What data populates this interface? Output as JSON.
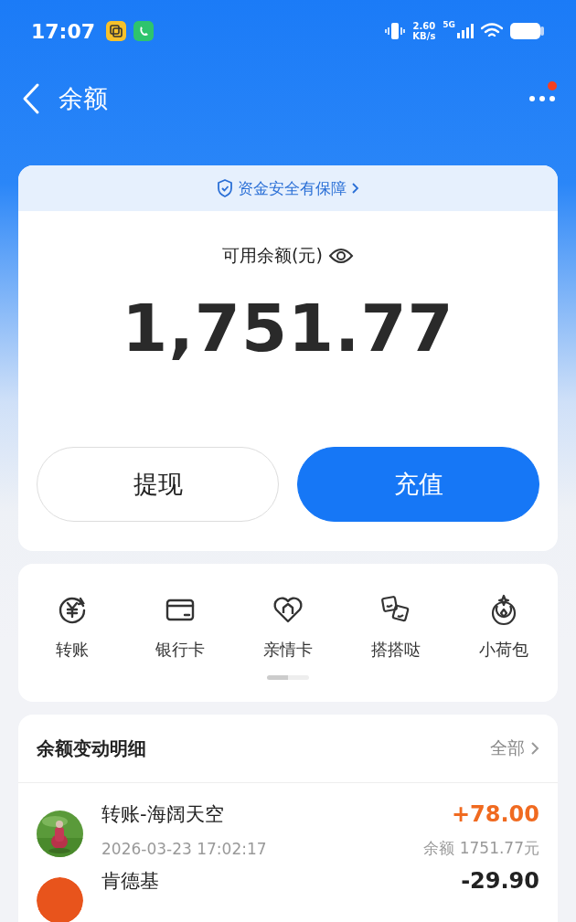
{
  "status_bar": {
    "time": "17:07",
    "network_speed": "2.60",
    "network_unit": "KB/s",
    "network_type": "5G"
  },
  "nav": {
    "title": "余额",
    "notification_dot": true
  },
  "balance_card": {
    "safety_banner": "资金安全有保障",
    "balance_label": "可用余额(元)",
    "balance": "1,751.77",
    "buttons": [
      {
        "label": "提现",
        "kind": "secondary"
      },
      {
        "label": "充值",
        "kind": "primary"
      }
    ]
  },
  "shortcuts": {
    "items": [
      {
        "label": "转账",
        "kind": "transfer"
      },
      {
        "label": "银行卡",
        "kind": "card"
      },
      {
        "label": "亲情卡",
        "kind": "family"
      },
      {
        "label": "搭搭哒",
        "kind": "dice"
      },
      {
        "label": "小荷包",
        "kind": "pouch"
      }
    ],
    "pages": [
      {
        "selected": true
      },
      {
        "selected": false
      }
    ]
  },
  "details": {
    "title": "余额变动明细",
    "filter": "全部",
    "rows": [
      {
        "title": "转账-海阔天空",
        "time": "2026-03-23 17:02:17",
        "amount": "+78.00",
        "balance": "余额 1751.77元",
        "kind": "income"
      },
      {
        "title": "肯德基",
        "amount": "-29.90",
        "kind": "expense"
      }
    ]
  }
}
